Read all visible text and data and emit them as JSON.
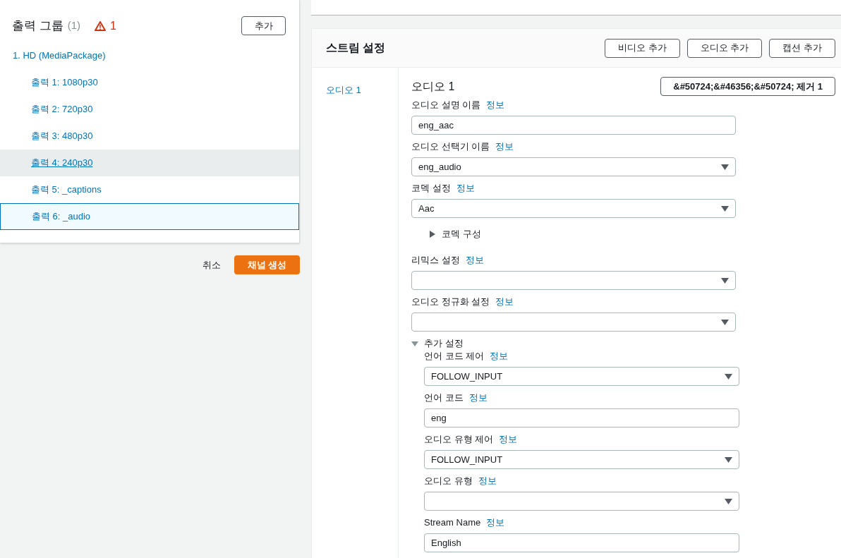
{
  "output_groups": {
    "title": "출력 그룹",
    "count": "(1)",
    "warning_count": "1",
    "add_button": "추가",
    "tree": [
      {
        "label": "1. HD (MediaPackage)",
        "children": [
          {
            "label": "출력 1: 1080p30",
            "selected": false,
            "hovered": false
          },
          {
            "label": "출력 2: 720p30",
            "selected": false,
            "hovered": false
          },
          {
            "label": "출력 3: 480p30",
            "selected": false,
            "hovered": false
          },
          {
            "label": "출력 4: 240p30",
            "selected": false,
            "hovered": true
          },
          {
            "label": "출력 5: _captions",
            "selected": false,
            "hovered": false
          },
          {
            "label": "출력 6: _audio",
            "selected": true,
            "hovered": false
          }
        ]
      }
    ]
  },
  "footer": {
    "cancel": "취소",
    "create": "채널 생성"
  },
  "stream_settings": {
    "title": "스트림 설정",
    "buttons": [
      "비디오 추가",
      "오디오 추가",
      "캡션 추가"
    ],
    "nav": [
      "오디오 1"
    ],
    "section_title": "오디오 1",
    "remove_button": "&#50724;&#46356;&#50724; 제거 1",
    "fields": [
      {
        "kind": "input",
        "label": "오디오 설명 이름",
        "info": "정보",
        "value": "eng_aac"
      },
      {
        "kind": "select",
        "label": "오디오 선택기 이름",
        "info": "정보",
        "value": "eng_audio"
      },
      {
        "kind": "select",
        "label": "코덱 설정",
        "info": "정보",
        "value": "Aac"
      },
      {
        "kind": "expander",
        "label": "코덱 구성",
        "expanded": false
      },
      {
        "kind": "select",
        "label": "리믹스 설정",
        "info": "정보"
      },
      {
        "kind": "select",
        "label": "오디오 정규화 설정",
        "info": "정보"
      },
      {
        "kind": "group",
        "label": "추가 설정",
        "expanded": true,
        "children": [
          {
            "kind": "select",
            "label": "언어 코드 제어",
            "info": "정보",
            "value": "FOLLOW_INPUT"
          },
          {
            "kind": "input",
            "label": "언어 코드",
            "info": "정보",
            "value": "eng"
          },
          {
            "kind": "select",
            "label": "오디오 유형 제어",
            "info": "정보",
            "value": "FOLLOW_INPUT"
          },
          {
            "kind": "select",
            "label": "오디오 유형",
            "info": "정보"
          },
          {
            "kind": "input",
            "label": "Stream Name",
            "info": "정보",
            "value": "English"
          }
        ]
      }
    ]
  }
}
